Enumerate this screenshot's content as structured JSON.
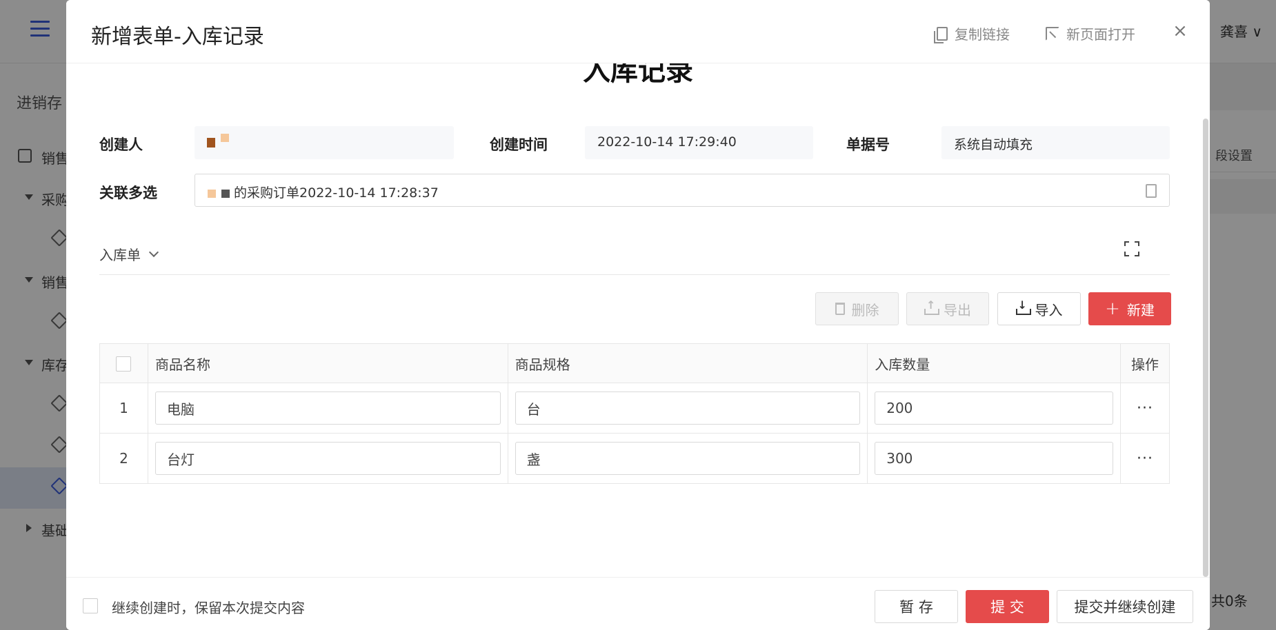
{
  "background": {
    "user_name": "龚喜 ∨",
    "breadcrumb": "进销存",
    "nav": [
      {
        "label": "销售",
        "kind": "module"
      },
      {
        "label": "采购",
        "kind": "group"
      },
      {
        "label": "",
        "kind": "item"
      },
      {
        "label": "销售",
        "kind": "group"
      },
      {
        "label": "",
        "kind": "item"
      },
      {
        "label": "库存",
        "kind": "group"
      },
      {
        "label": "",
        "kind": "item"
      },
      {
        "label": "",
        "kind": "item"
      },
      {
        "label": "",
        "kind": "item-active"
      },
      {
        "label": "基础",
        "kind": "group-collapsed"
      }
    ],
    "right_tab": "段设置",
    "total_text": "共0条"
  },
  "modal": {
    "title": "新增表单-入库记录",
    "copy_link": "复制链接",
    "open_new_page": "新页面打开",
    "close": "×",
    "form_title": "入库记录",
    "fields": {
      "creator_label": "创建人",
      "create_time_label": "创建时间",
      "create_time_value": "2022-10-14 17:29:40",
      "doc_no_label": "单据号",
      "doc_no_value": "系统自动填充",
      "related_label": "关联多选",
      "related_value": "的采购订单2022-10-14 17:28:37"
    },
    "section": {
      "title": "入库单"
    },
    "toolbar": {
      "delete": "删除",
      "export": "导出",
      "import": "导入",
      "create": "新建"
    },
    "table": {
      "columns": [
        "商品名称",
        "商品规格",
        "入库数量",
        "操作"
      ],
      "rows": [
        {
          "index": "1",
          "name": "电脑",
          "spec": "台",
          "qty": "200"
        },
        {
          "index": "2",
          "name": "台灯",
          "spec": "盏",
          "qty": "300"
        }
      ],
      "action_icon": "···"
    },
    "footer": {
      "keep_text": "继续创建时，保留本次提交内容",
      "save_draft": "暂 存",
      "submit": "提 交",
      "submit_continue": "提交并继续创建"
    }
  },
  "colors": {
    "primary": "#e54b4b",
    "accent_blue": "#3b5bdb"
  }
}
